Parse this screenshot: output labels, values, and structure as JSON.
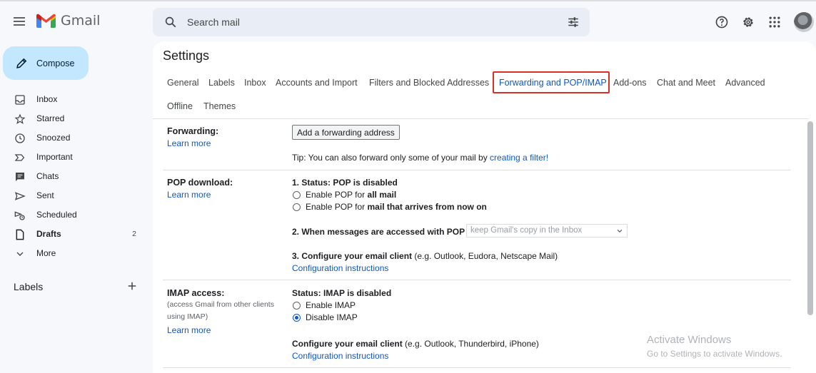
{
  "header": {
    "app_name": "Gmail",
    "search_placeholder": "Search mail"
  },
  "sidebar": {
    "compose_label": "Compose",
    "items": [
      {
        "label": "Inbox",
        "icon": "inbox-icon"
      },
      {
        "label": "Starred",
        "icon": "star-icon"
      },
      {
        "label": "Snoozed",
        "icon": "clock-icon"
      },
      {
        "label": "Important",
        "icon": "important-icon"
      },
      {
        "label": "Chats",
        "icon": "chat-icon"
      },
      {
        "label": "Sent",
        "icon": "send-icon"
      },
      {
        "label": "Scheduled",
        "icon": "scheduled-send-icon"
      },
      {
        "label": "Drafts",
        "icon": "draft-icon",
        "count": "2"
      },
      {
        "label": "More",
        "icon": "chevron-down-icon"
      }
    ],
    "labels_heading": "Labels"
  },
  "settings": {
    "title": "Settings",
    "tabs": [
      "General",
      "Labels",
      "Inbox",
      "Accounts and Import",
      "Filters and Blocked Addresses",
      "Forwarding and POP/IMAP",
      "Add-ons",
      "Chat and Meet",
      "Advanced",
      "Offline",
      "Themes"
    ],
    "active_tab": "Forwarding and POP/IMAP"
  },
  "forwarding": {
    "label": "Forwarding:",
    "learn_more": "Learn more",
    "add_button": "Add a forwarding address",
    "tip_prefix": "Tip: You can also forward only some of your mail by ",
    "tip_link": "creating a filter!"
  },
  "pop": {
    "label": "POP download:",
    "learn_more": "Learn more",
    "status": "1. Status: POP is disabled",
    "opt1_prefix": "Enable POP for ",
    "opt1_bold": "all mail",
    "opt2_prefix": "Enable POP for ",
    "opt2_bold": "mail that arrives from now on",
    "step2": "2. When messages are accessed with POP",
    "step2_select": "keep Gmail's copy in the Inbox",
    "step3_bold": "3. Configure your email client",
    "step3_rest": " (e.g. Outlook, Eudora, Netscape Mail)",
    "config_link": "Configuration instructions"
  },
  "imap": {
    "label": "IMAP access:",
    "note": "(access Gmail from other clients using IMAP)",
    "learn_more": "Learn more",
    "status": "Status: IMAP is disabled",
    "enable": "Enable IMAP",
    "disable": "Disable IMAP",
    "selected": "Disable IMAP",
    "configure_bold": "Configure your email client",
    "configure_rest": " (e.g. Outlook, Thunderbird, iPhone)",
    "config_link": "Configuration instructions"
  },
  "watermark": {
    "line1": "Activate Windows",
    "line2": "Go to Settings to activate Windows."
  },
  "colors": {
    "accent": "#0b57d0",
    "compose_bg": "#c2e7ff",
    "highlight_box": "#d93025"
  }
}
